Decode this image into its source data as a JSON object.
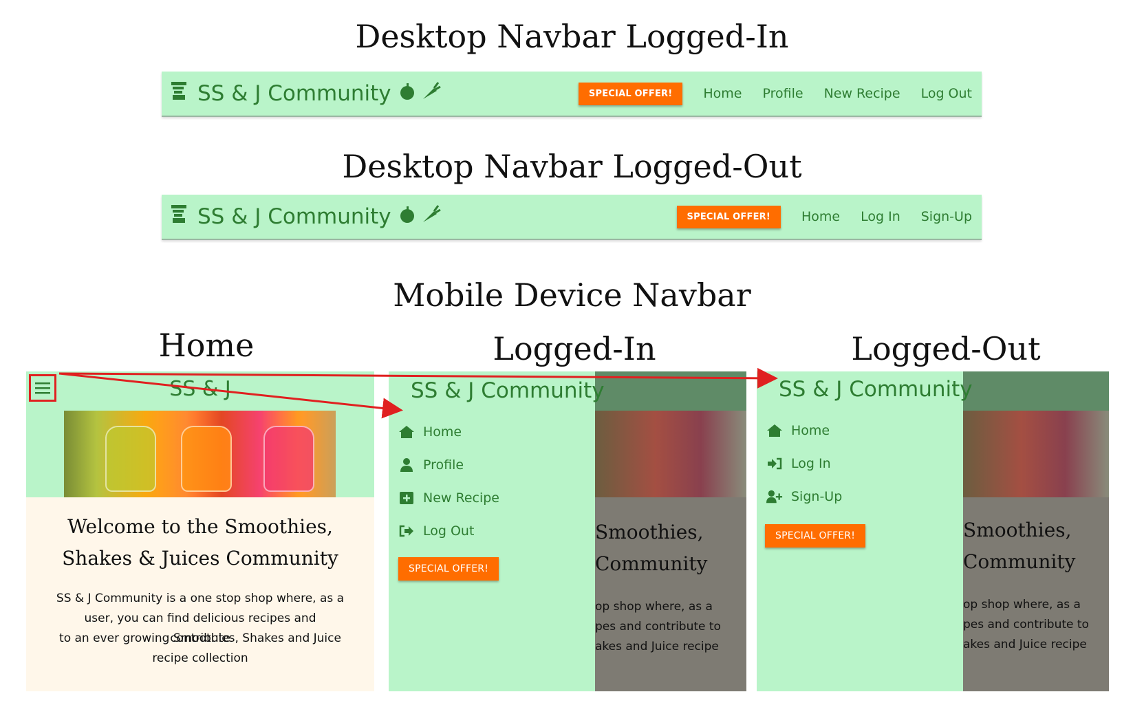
{
  "headings": {
    "desktop_logged_in": "Desktop Navbar Logged-In",
    "desktop_logged_out": "Desktop Navbar Logged-Out",
    "mobile": "Mobile Device Navbar",
    "home": "Home",
    "logged_in": "Logged-In",
    "logged_out": "Logged-Out"
  },
  "brand": {
    "name": "SS & J Community",
    "short": "SS & J",
    "color": "#2e7d32"
  },
  "colors": {
    "navbar_bg": "#b9f4c9",
    "offer_bg": "#ff6d00",
    "content_bg": "#fff7ea",
    "overlay": "#7e7b73",
    "arrow": "#e02020"
  },
  "desktop_logged_in": {
    "offer": "SPECIAL OFFER!",
    "links": [
      "Home",
      "Profile",
      "New Recipe",
      "Log Out"
    ]
  },
  "desktop_logged_out": {
    "offer": "SPECIAL OFFER!",
    "links": [
      "Home",
      "Log In",
      "Sign-Up"
    ]
  },
  "mobile_home": {
    "menu_icon": "hamburger-icon",
    "welcome_line1": "Welcome to the Smoothies,",
    "welcome_line2": "Shakes & Juices Community",
    "para": [
      "SS & J Community is a one stop shop where, as a",
      "user, you can find delicious recipes and contribute",
      "to an ever growing Smoothies, Shakes and Juice",
      "recipe collection"
    ]
  },
  "mobile_logged_in": {
    "items": [
      {
        "label": "Home",
        "icon": "home-icon"
      },
      {
        "label": "Profile",
        "icon": "user-icon"
      },
      {
        "label": "New Recipe",
        "icon": "plus-square-icon"
      },
      {
        "label": "Log Out",
        "icon": "sign-out-icon"
      }
    ],
    "offer": "SPECIAL OFFER!",
    "bg_title1": "Smoothies,",
    "bg_title2": "Community",
    "bg_para": [
      "op shop where, as a",
      "pes and contribute to",
      "akes and Juice recipe"
    ]
  },
  "mobile_logged_out": {
    "items": [
      {
        "label": "Home",
        "icon": "home-icon"
      },
      {
        "label": "Log In",
        "icon": "sign-in-icon"
      },
      {
        "label": "Sign-Up",
        "icon": "user-plus-icon"
      }
    ],
    "offer": "SPECIAL OFFER!",
    "bg_title1": "Smoothies,",
    "bg_title2": "Community",
    "bg_para": [
      "op shop where, as a",
      "pes and contribute to",
      "akes and Juice recipe"
    ]
  }
}
